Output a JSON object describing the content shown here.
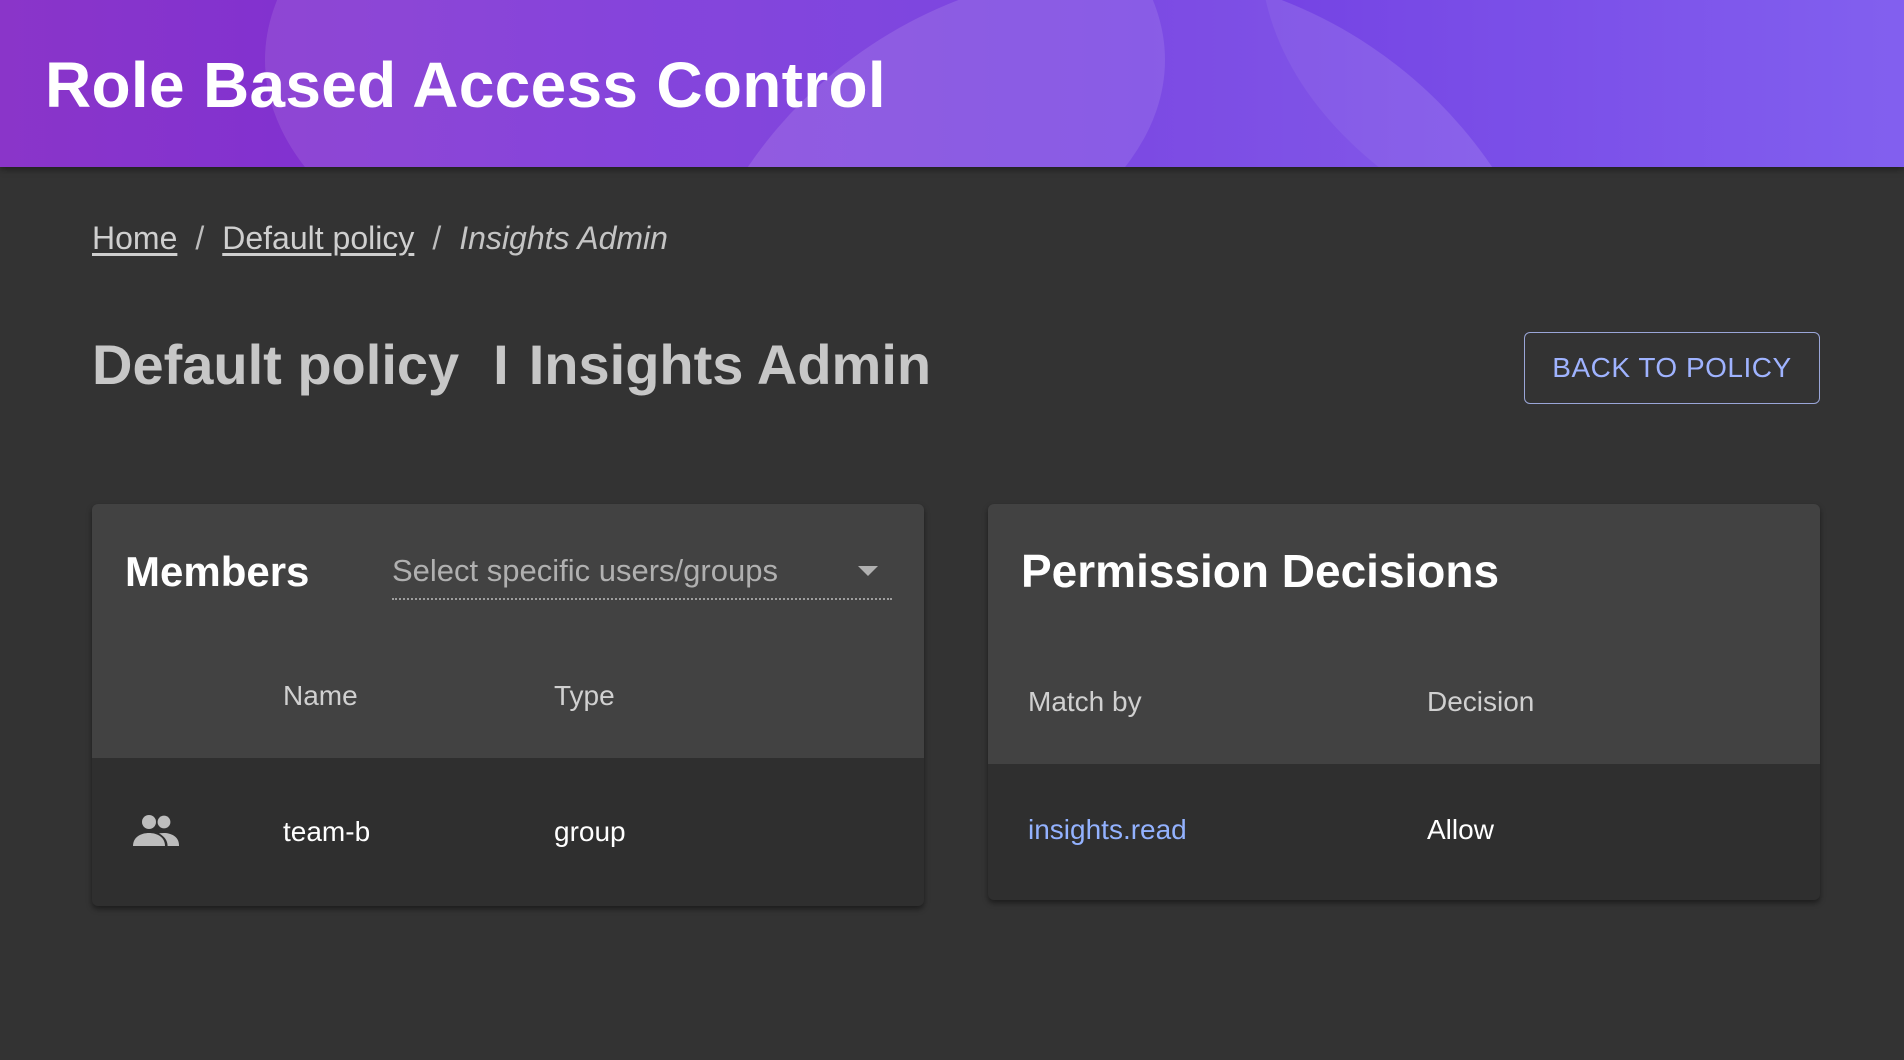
{
  "header": {
    "title": "Role Based Access Control"
  },
  "breadcrumb": {
    "home": "Home",
    "sep1": "/",
    "policy": "Default policy",
    "sep2": "/",
    "current": "Insights Admin"
  },
  "page": {
    "policy_name": "Default policy",
    "divider": "I",
    "role_name": "Insights Admin",
    "back_button": "BACK TO POLICY"
  },
  "members": {
    "title": "Members",
    "select_placeholder": "Select specific users/groups",
    "columns": {
      "name": "Name",
      "type": "Type"
    },
    "rows": [
      {
        "icon": "group-icon",
        "name": "team-b",
        "type": "group"
      }
    ]
  },
  "permissions": {
    "title": "Permission Decisions",
    "columns": {
      "match_by": "Match by",
      "decision": "Decision"
    },
    "rows": [
      {
        "match_by": "insights.read",
        "decision": "Allow"
      }
    ]
  },
  "colors": {
    "accent_link": "#93b2ff",
    "header_gradient_start": "#8a35c9",
    "header_gradient_end": "#7b56ee",
    "background": "#333333",
    "card_header": "#424242"
  }
}
